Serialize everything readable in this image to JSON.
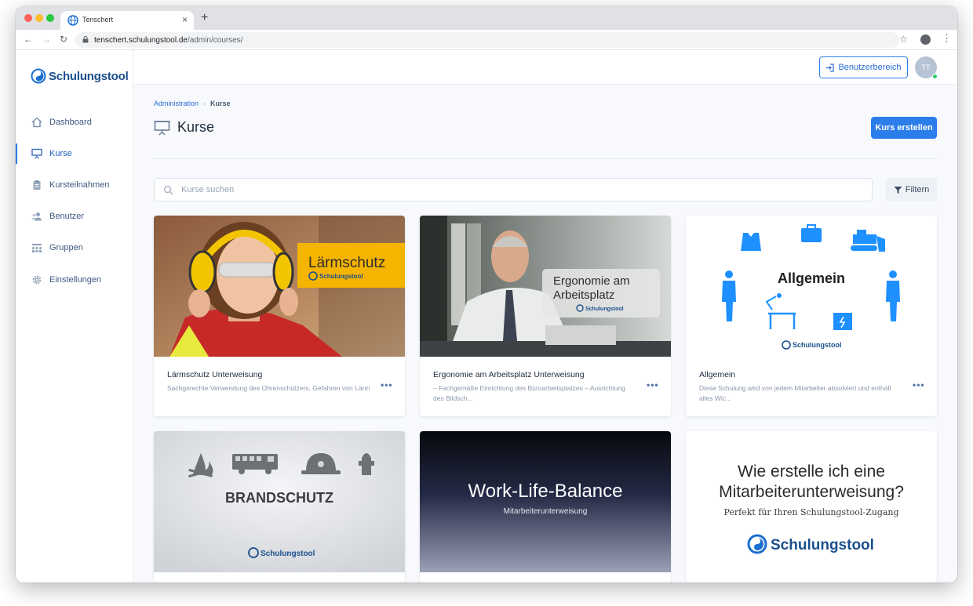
{
  "browser": {
    "tab_title": "Tenschert",
    "tab_close": "×",
    "new_tab": "+",
    "url_host": "tenschert.schulungstool.de",
    "url_path": "/admin/courses/"
  },
  "sidebar": {
    "logo_text": "Schulungstool",
    "items": [
      {
        "label": "Dashboard",
        "icon": "home-icon"
      },
      {
        "label": "Kurse",
        "icon": "presentation-icon"
      },
      {
        "label": "Kursteilnahmen",
        "icon": "clipboard-icon"
      },
      {
        "label": "Benutzer",
        "icon": "users-icon"
      },
      {
        "label": "Gruppen",
        "icon": "groups-icon"
      },
      {
        "label": "Einstellungen",
        "icon": "gear-icon"
      }
    ]
  },
  "topbar": {
    "benutzerbereich_label": "Benutzerbereich",
    "avatar_initials": "TT"
  },
  "breadcrumb": {
    "parent": "Administration",
    "current": "Kurse"
  },
  "page": {
    "title": "Kurse",
    "create_button": "Kurs erstellen",
    "search_placeholder": "Kurse suchen",
    "filter_button": "Filtern"
  },
  "colors": {
    "accent": "#2b7de9",
    "brand": "#1b4f8d",
    "laerm_yellow": "#f5b400",
    "allgemein_blue": "#1e90ff"
  },
  "cards": [
    {
      "title": "Lärmschutz Unterweisung",
      "description": "Sachgerechte Verwendung des Ohrenschützers, Gefahren von Lärm",
      "image_label": "Lärmschutz",
      "image_brand": "Schulungstool"
    },
    {
      "title": "Ergonomie am Arbeitsplatz Unterweisung",
      "description": "– Fachgemäße Einrichtung des Büroarbeitsplatzes – Ausrichtung des Bildsch...",
      "image_label_line1": "Ergonomie am",
      "image_label_line2": "Arbeitsplatz",
      "image_brand": "Schulungstool"
    },
    {
      "title": "Allgemein",
      "description": "Diese Schulung wird von jedem Mitarbeiter absolviert und enthält alles Wic...",
      "image_label": "Allgemein",
      "image_brand": "Schulungstool"
    },
    {
      "image_label": "BRANDSCHUTZ",
      "image_brand": "Schulungstool"
    },
    {
      "image_label": "Work-Life-Balance",
      "image_sublabel": "Mitarbeiterunterweisung"
    },
    {
      "image_label_line1": "Wie erstelle ich eine",
      "image_label_line2": "Mitarbeiterunterweisung?",
      "image_sublabel": "Perfekt für Ihren Schulungstool-Zugang",
      "image_brand": "Schulungstool"
    }
  ],
  "card_menu_label": "•••"
}
